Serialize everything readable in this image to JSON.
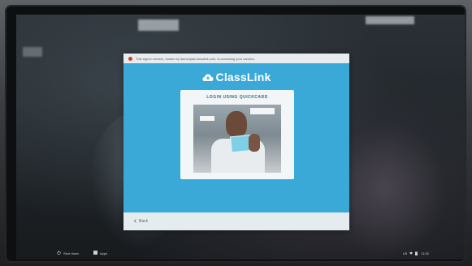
{
  "secure_bar": {
    "text": "This sign-in service, hosted by launchpad.classlink.com, is accessing your camera."
  },
  "brand": {
    "name": "ClassLink",
    "accent": "#3aa9d8"
  },
  "card": {
    "title": "LOGIN USING QUICKCARD"
  },
  "footer": {
    "back_label": "Back"
  },
  "shelf": {
    "shutdown_label": "Shut down",
    "apps_label": "Apps",
    "tray_locale": "US",
    "tray_time": "11:52"
  },
  "icons": {
    "warning": "warning-dot-icon",
    "cloud": "classlink-cloud-icon",
    "back": "chevron-left-icon",
    "power": "power-icon",
    "apps": "apps-grid-icon",
    "wifi": "wifi-icon",
    "battery": "battery-icon"
  }
}
